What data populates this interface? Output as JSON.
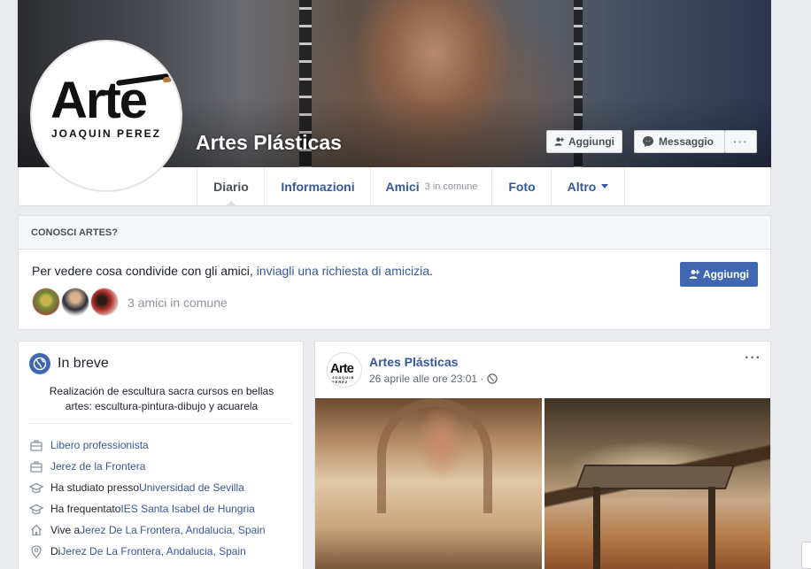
{
  "header": {
    "page_name": "Artes Plásticas",
    "add_friend_label": "Aggiungi",
    "message_label": "Messaggio",
    "more_label": "···"
  },
  "profile_logo": {
    "word": "Arte",
    "sub": "JOAQUIN PEREZ"
  },
  "tabs": [
    {
      "label": "Diario",
      "active": true
    },
    {
      "label": "Informazioni"
    },
    {
      "label": "Amici",
      "sub": "3 in comune"
    },
    {
      "label": "Foto"
    },
    {
      "label": "Altro"
    }
  ],
  "conosci": {
    "heading": "CONOSCI ARTES?",
    "text_plain": "Per vedere cosa condivide con gli amici, ",
    "text_link": "inviagli una richiesta di amicizia",
    "text_end": ".",
    "add_label": "Aggiungi",
    "mutual_text": "3 amici in comune"
  },
  "intro": {
    "title": "In breve",
    "bio": "Realización de escultura sacra cursos en bellas artes: escultura-pintura-dibujo y acuarela",
    "rows": [
      {
        "icon": "briefcase-icon",
        "link": "Libero professionista"
      },
      {
        "icon": "briefcase-icon",
        "link": "Jerez de la Frontera"
      },
      {
        "icon": "graduation-cap-icon",
        "prefix": "Ha studiato presso ",
        "link": "Universidad de Sevilla"
      },
      {
        "icon": "graduation-cap-icon",
        "prefix": "Ha frequentato ",
        "link": "IES Santa Isabel de Hungria"
      },
      {
        "icon": "home-icon",
        "prefix": "Vive a ",
        "link": "Jerez De La Frontera, Andalucia, Spain"
      },
      {
        "icon": "location-pin-icon",
        "prefix": "Di ",
        "link": "Jerez De La Frontera, Andalucia, Spain"
      }
    ]
  },
  "post": {
    "author": "Artes Plásticas",
    "date": "26 aprile alle ore 23:01 ·",
    "menu": "···",
    "avatar_word": "Arte",
    "avatar_sub": "JOAQUIN PEREZ"
  },
  "colors": {
    "link": "#365899",
    "button_blue": "#4267b2",
    "background": "#e9ebee"
  }
}
